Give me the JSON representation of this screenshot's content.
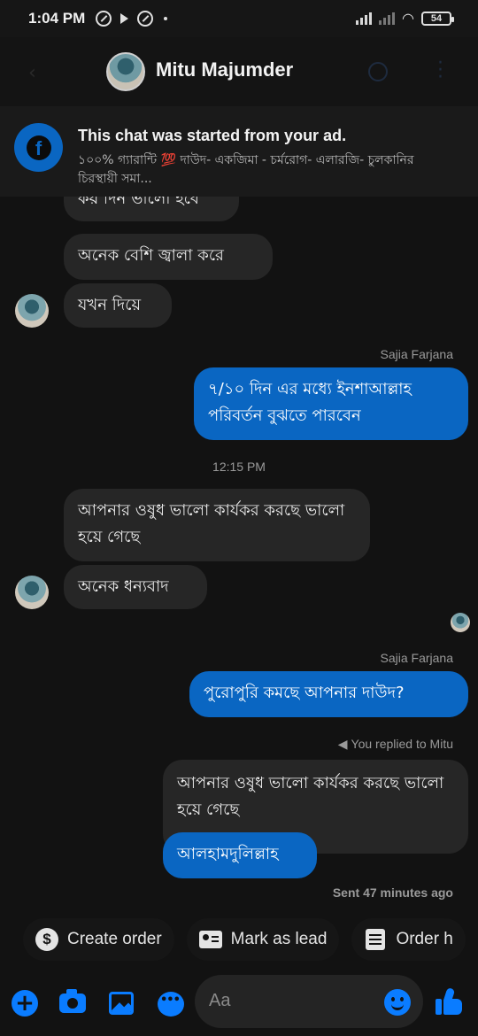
{
  "status_bar": {
    "time": "1:04 PM",
    "battery": "54"
  },
  "header": {
    "contact_name": "Mitu Majumder"
  },
  "ad_banner": {
    "title": "This chat was started from your ad.",
    "subtitle": "১০০% গ্যারান্টি 💯 দাউদ- একজিমা - চর্মরোগ-  এলারজি- চুলকানির চিরস্থায়ী সমা..."
  },
  "messages": {
    "m0": "কয় দিন ভালো হবে",
    "m1": "অনেক বেশি জ্বালা করে",
    "m2": "যখন দিয়ে",
    "sender1": "Sajia Farjana",
    "m3": "৭/১০ দিন এর মধ্যে ইনশাআল্লাহ পরিবর্তন বুঝতে পারবেন",
    "time1": "12:15 PM",
    "m4": "আপনার ওষুধ ভালো কার্যকর করছে ভালো হয়ে গেছে",
    "m5": "অনেক ধন্যবাদ",
    "sender2": "Sajia Farjana",
    "m6": "পুরোপুরি কমছে আপনার দাউদ?",
    "reply_note": "You replied to Mitu",
    "quoted": "আপনার ওষুধ ভালো কার্যকর করছে ভালো হয়ে গেছে",
    "m7": "আলহামদুলিল্লাহ",
    "sent_status": "Sent 47 minutes ago"
  },
  "quick_actions": {
    "create_order": "Create order",
    "mark_as_lead": "Mark as lead",
    "order_history": "Order h"
  },
  "composer": {
    "placeholder": "Aa"
  },
  "colors": {
    "accent": "#0a66c2",
    "icon_blue": "#0a7cff",
    "incoming_bubble": "#262626",
    "background": "#121212"
  }
}
